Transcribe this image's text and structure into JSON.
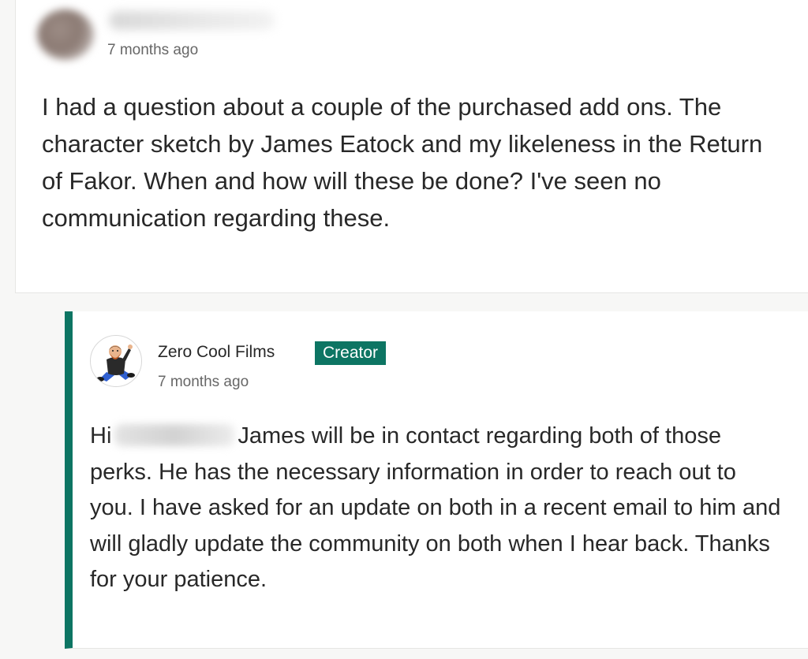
{
  "comment": {
    "author_name": "",
    "timestamp": "7 months ago",
    "text": "I had a question about a couple of the purchased add ons. The character sketch by James Eatock and my likeleness in the Return of Fakor. When and how will these be done? I've seen no communication regarding these."
  },
  "reply": {
    "author_name": "Zero Cool Films",
    "badge": "Creator",
    "timestamp": "7 months ago",
    "greeting": "Hi",
    "text": "James will be in contact regarding both of those perks. He has the necessary information in order to reach out to you. I have asked for an update on both in a recent email to him and will gladly update the community on both when I hear back. Thanks for your patience."
  },
  "colors": {
    "accent": "#0d7563",
    "background": "#f7f7f6",
    "text": "#282828",
    "muted": "#676767"
  },
  "icons": {
    "commenter_avatar": "blurred-avatar",
    "creator_avatar": "bearded-cartoon-avatar"
  }
}
